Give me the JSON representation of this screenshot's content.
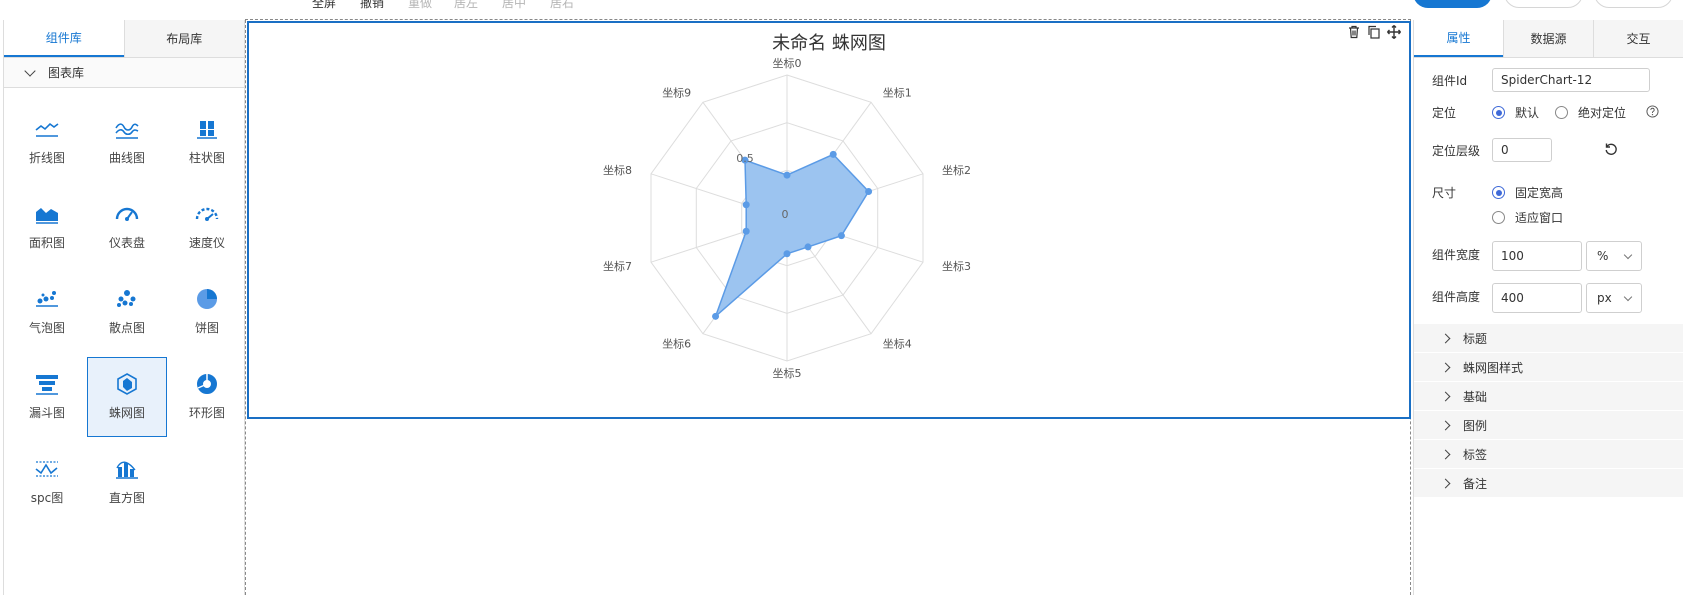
{
  "toolbar": {
    "items": [
      {
        "label": "全屏",
        "disabled": false
      },
      {
        "label": "撤销",
        "disabled": false
      },
      {
        "label": "重做",
        "disabled": true
      },
      {
        "label": "居左",
        "disabled": true
      },
      {
        "label": "居中",
        "disabled": true
      },
      {
        "label": "居右",
        "disabled": true
      }
    ]
  },
  "left_panel": {
    "tabs": [
      "组件库",
      "布局库"
    ],
    "section": "图表库",
    "components": [
      {
        "label": "折线图",
        "icon": "line-chart-icon"
      },
      {
        "label": "曲线图",
        "icon": "curve-chart-icon"
      },
      {
        "label": "柱状图",
        "icon": "bar-chart-icon"
      },
      {
        "label": "面积图",
        "icon": "area-chart-icon"
      },
      {
        "label": "仪表盘",
        "icon": "gauge-icon"
      },
      {
        "label": "速度仪",
        "icon": "speedometer-icon"
      },
      {
        "label": "气泡图",
        "icon": "bubble-chart-icon"
      },
      {
        "label": "散点图",
        "icon": "scatter-chart-icon"
      },
      {
        "label": "饼图",
        "icon": "pie-chart-icon"
      },
      {
        "label": "漏斗图",
        "icon": "funnel-chart-icon"
      },
      {
        "label": "蛛网图",
        "icon": "radar-chart-icon",
        "selected": true
      },
      {
        "label": "环形图",
        "icon": "donut-chart-icon"
      },
      {
        "label": "spc图",
        "icon": "spc-chart-icon"
      },
      {
        "label": "直方图",
        "icon": "histogram-icon"
      }
    ]
  },
  "chart_data": {
    "type": "radar",
    "title": "未命名 蛛网图",
    "indicators": [
      "坐标0",
      "坐标1",
      "坐标2",
      "坐标3",
      "坐标4",
      "坐标5",
      "坐标6",
      "坐标7",
      "坐标8",
      "坐标9"
    ],
    "values": [
      0.3,
      0.55,
      0.6,
      0.4,
      0.25,
      0.25,
      0.85,
      0.3,
      0.3,
      0.5
    ],
    "max": 1,
    "tick_labels": [
      "0",
      "0.5"
    ],
    "color": "#5b9be6",
    "fill": "#9cc4f0"
  },
  "right_panel": {
    "tabs": [
      "属性",
      "数据源",
      "交互"
    ],
    "component_id_label": "组件Id",
    "component_id": "SpiderChart-12",
    "position_label": "定位",
    "position_options": [
      "默认",
      "绝对定位"
    ],
    "zindex_label": "定位层级",
    "zindex": "0",
    "size_label": "尺寸",
    "size_options": [
      "固定宽高",
      "适应窗口"
    ],
    "width_label": "组件宽度",
    "width": "100",
    "width_unit": "%",
    "height_label": "组件高度",
    "height": "400",
    "height_unit": "px",
    "sections": [
      "标题",
      "蛛网图样式",
      "基础",
      "图例",
      "标签",
      "备注"
    ]
  },
  "colors": {
    "accent": "#1677d2"
  }
}
